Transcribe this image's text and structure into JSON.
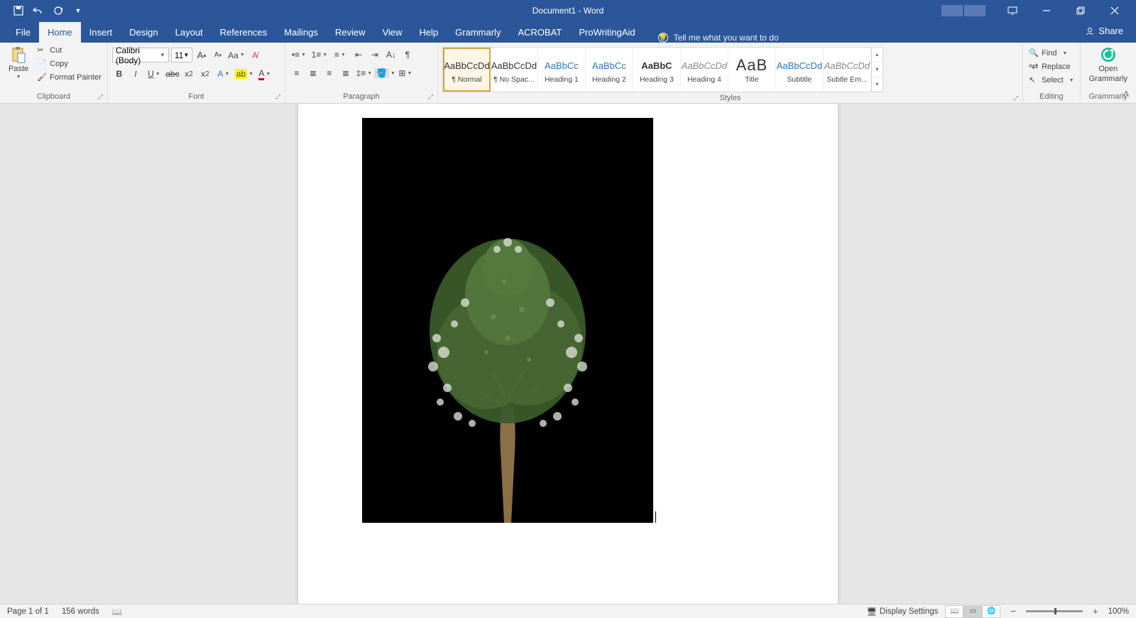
{
  "titlebar": {
    "document_title": "Document1 - Word"
  },
  "tabs": {
    "file": "File",
    "home": "Home",
    "insert": "Insert",
    "design": "Design",
    "layout": "Layout",
    "references": "References",
    "mailings": "Mailings",
    "review": "Review",
    "view": "View",
    "help": "Help",
    "grammarly": "Grammarly",
    "acrobat": "ACROBAT",
    "prowritingaid": "ProWritingAid",
    "tellme": "Tell me what you want to do",
    "share": "Share"
  },
  "ribbon": {
    "clipboard": {
      "label": "Clipboard",
      "paste": "Paste",
      "cut": "Cut",
      "copy": "Copy",
      "format_painter": "Format Painter"
    },
    "font": {
      "label": "Font",
      "name": "Calibri (Body)",
      "size": "11"
    },
    "paragraph": {
      "label": "Paragraph"
    },
    "styles": {
      "label": "Styles",
      "preview_text": "AaBbCcDd",
      "preview_heading": "AaBbCc",
      "preview_title": "AaB",
      "items": [
        {
          "name": "¶ Normal",
          "class": ""
        },
        {
          "name": "¶ No Spac...",
          "class": ""
        },
        {
          "name": "Heading 1",
          "class": "blue"
        },
        {
          "name": "Heading 2",
          "class": "blue"
        },
        {
          "name": "Heading 3",
          "class": ""
        },
        {
          "name": "Heading 4",
          "class": "gray"
        },
        {
          "name": "Title",
          "class": "big"
        },
        {
          "name": "Subtitle",
          "class": "blue"
        },
        {
          "name": "Subtle Em...",
          "class": "gray"
        }
      ]
    },
    "editing": {
      "label": "Editing",
      "find": "Find",
      "replace": "Replace",
      "select": "Select"
    },
    "grammarly": {
      "label": "Grammarly",
      "open1": "Open",
      "open2": "Grammarly"
    }
  },
  "statusbar": {
    "page": "Page 1 of 1",
    "words": "156 words",
    "display_settings": "Display Settings",
    "zoom": "100%"
  }
}
